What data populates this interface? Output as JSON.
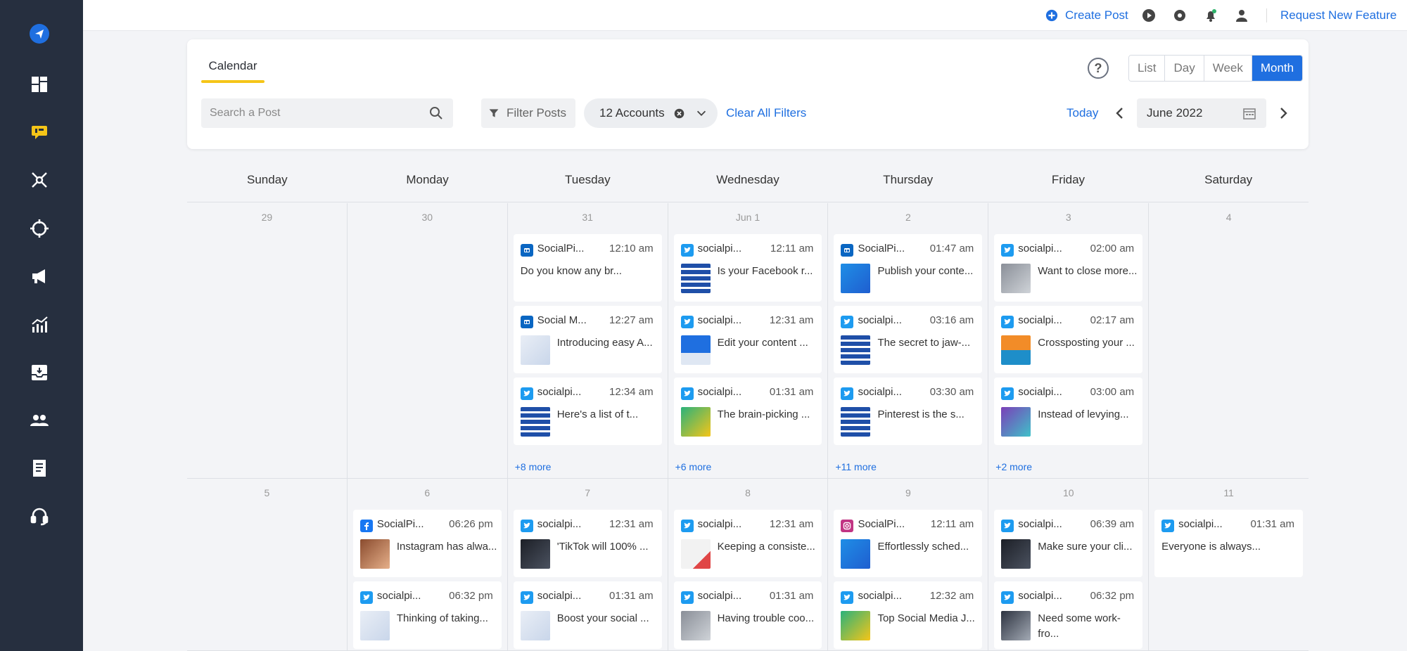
{
  "colors": {
    "accent": "#1f6fe0",
    "twitter": "#1d9bf0",
    "facebook": "#1877f2",
    "linkedin": "#0a66c2",
    "instagram": "#c13584",
    "sidebar_bg": "#262f3f",
    "tab_underline": "#f5c518",
    "active_nav": "#f5c518"
  },
  "sidebar": {
    "items": [
      {
        "icon": "send-icon"
      },
      {
        "icon": "dashboard-icon"
      },
      {
        "icon": "chat-icon",
        "active": true
      },
      {
        "icon": "network-icon"
      },
      {
        "icon": "target-icon"
      },
      {
        "icon": "megaphone-icon"
      },
      {
        "icon": "analytics-icon"
      },
      {
        "icon": "inbox-icon"
      },
      {
        "icon": "users-icon"
      },
      {
        "icon": "report-icon"
      },
      {
        "icon": "headset-icon"
      }
    ]
  },
  "topbar": {
    "create_post": "Create Post",
    "request_feature": "Request New Feature",
    "icons": [
      "play-icon",
      "settings-icon",
      "bell-icon",
      "user-icon"
    ]
  },
  "calendar": {
    "tab": "Calendar",
    "help": "?",
    "views": [
      "List",
      "Day",
      "Week",
      "Month"
    ],
    "active_view": "Month",
    "search_placeholder": "Search a Post",
    "filter_label": "Filter Posts",
    "accounts_label": "12 Accounts",
    "clear_filters": "Clear All Filters",
    "today": "Today",
    "month": "June 2022",
    "days_of_week": [
      "Sunday",
      "Monday",
      "Tuesday",
      "Wednesday",
      "Thursday",
      "Friday",
      "Saturday"
    ],
    "weeks": [
      {
        "days": [
          {
            "num": "29",
            "posts": []
          },
          {
            "num": "30",
            "posts": []
          },
          {
            "num": "31",
            "posts": [
              {
                "net": "linkedin",
                "account": "SocialPi...",
                "time": "12:10 am",
                "text": "Do you know any br...",
                "thumb": null
              },
              {
                "net": "linkedin",
                "account": "Social M...",
                "time": "12:27 am",
                "text": "Introducing easy A...",
                "thumb": "light"
              },
              {
                "net": "twitter",
                "account": "socialpi...",
                "time": "12:34 am",
                "text": "Here's a list of t...",
                "thumb": "blue-grid"
              }
            ],
            "more": "+8 more"
          },
          {
            "num": "Jun 1",
            "posts": [
              {
                "net": "twitter",
                "account": "socialpi...",
                "time": "12:11 am",
                "text": "Is your Facebook r...",
                "thumb": "blue-grid"
              },
              {
                "net": "twitter",
                "account": "socialpi...",
                "time": "12:31 am",
                "text": "Edit your content ...",
                "thumb": "blue-device"
              },
              {
                "net": "twitter",
                "account": "socialpi...",
                "time": "01:31 am",
                "text": "The brain-picking ...",
                "thumb": "green"
              }
            ],
            "more": "+6 more"
          },
          {
            "num": "2",
            "posts": [
              {
                "net": "linkedin",
                "account": "SocialPi...",
                "time": "01:47 am",
                "text": "Publish your conte...",
                "thumb": "blue-solid"
              },
              {
                "net": "twitter",
                "account": "socialpi...",
                "time": "03:16 am",
                "text": "The secret to jaw-...",
                "thumb": "blue-grid"
              },
              {
                "net": "twitter",
                "account": "socialpi...",
                "time": "03:30 am",
                "text": "Pinterest is the s...",
                "thumb": "blue-grid"
              }
            ],
            "more": "+11 more"
          },
          {
            "num": "3",
            "posts": [
              {
                "net": "twitter",
                "account": "socialpi...",
                "time": "02:00 am",
                "text": "Want to close more...",
                "thumb": "gray"
              },
              {
                "net": "twitter",
                "account": "socialpi...",
                "time": "02:17 am",
                "text": "Crossposting your ...",
                "thumb": "orange"
              },
              {
                "net": "twitter",
                "account": "socialpi...",
                "time": "03:00 am",
                "text": "Instead of levying...",
                "thumb": "purple"
              }
            ],
            "more": "+2 more"
          },
          {
            "num": "4",
            "posts": []
          }
        ]
      },
      {
        "days": [
          {
            "num": "5",
            "posts": []
          },
          {
            "num": "6",
            "posts": [
              {
                "net": "facebook",
                "account": "SocialPi...",
                "time": "06:26 pm",
                "text": "Instagram has alwa...",
                "thumb": "warm"
              },
              {
                "net": "twitter",
                "account": "socialpi...",
                "time": "06:32 pm",
                "text": "Thinking of taking...",
                "thumb": "light"
              }
            ]
          },
          {
            "num": "7",
            "posts": [
              {
                "net": "twitter",
                "account": "socialpi...",
                "time": "12:31 am",
                "text": "'TikTok will 100% ...",
                "thumb": "dark"
              },
              {
                "net": "twitter",
                "account": "socialpi...",
                "time": "01:31 am",
                "text": "Boost your social ...",
                "thumb": "light"
              }
            ]
          },
          {
            "num": "8",
            "posts": [
              {
                "net": "twitter",
                "account": "socialpi...",
                "time": "12:31 am",
                "text": "Keeping a consiste...",
                "thumb": "light-red"
              },
              {
                "net": "twitter",
                "account": "socialpi...",
                "time": "01:31 am",
                "text": "Having trouble coo...",
                "thumb": "gray"
              }
            ]
          },
          {
            "num": "9",
            "posts": [
              {
                "net": "instagram",
                "account": "SocialPi...",
                "time": "12:11 am",
                "text": "Effortlessly sched...",
                "thumb": "blue-solid"
              },
              {
                "net": "twitter",
                "account": "socialpi...",
                "time": "12:32 am",
                "text": "Top Social Media J...",
                "thumb": "green"
              }
            ]
          },
          {
            "num": "10",
            "posts": [
              {
                "net": "twitter",
                "account": "socialpi...",
                "time": "06:39 am",
                "text": "Make sure your cli...",
                "thumb": "dark"
              },
              {
                "net": "twitter",
                "account": "socialpi...",
                "time": "06:32 pm",
                "text": "Need some work-",
                "text2": "fro...",
                "thumb": "photo"
              }
            ]
          },
          {
            "num": "11",
            "posts": [
              {
                "net": "twitter",
                "account": "socialpi...",
                "time": "01:31 am",
                "text": "Everyone is always...",
                "thumb": null
              }
            ]
          }
        ]
      }
    ]
  }
}
